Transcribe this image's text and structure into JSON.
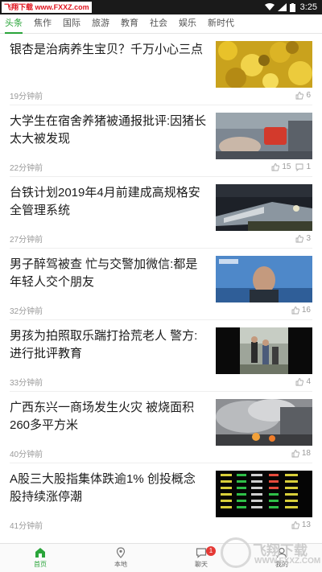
{
  "status_bar": {
    "watermark": "飞翔下载 www.FXXZ.com",
    "time": "3:25"
  },
  "tabs": [
    {
      "label": "头条",
      "active": true
    },
    {
      "label": "焦作"
    },
    {
      "label": "国际"
    },
    {
      "label": "旅游"
    },
    {
      "label": "教育"
    },
    {
      "label": "社会"
    },
    {
      "label": "娱乐"
    },
    {
      "label": "新时代"
    }
  ],
  "news": [
    {
      "title": "银杏是治病养生宝贝？千万小心三点",
      "time": "19分钟前",
      "likes": "6",
      "thumb": "ginkgo-leaves"
    },
    {
      "title": "大学生在宿舍养猪被通报批评:因猪长太大被发现",
      "time": "22分钟前",
      "likes": "15",
      "comments": "1",
      "thumb": "pig-in-dorm"
    },
    {
      "title": "台铁计划2019年4月前建成高规格安全管理系统",
      "time": "27分钟前",
      "likes": "3",
      "thumb": "train-accident"
    },
    {
      "title": "男子醉驾被查 忙与交警加微信:都是年轻人交个朋友",
      "time": "32分钟前",
      "likes": "16",
      "thumb": "drunk-driver"
    },
    {
      "title": "男孩为拍照取乐踹打拾荒老人 警方:进行批评教育",
      "time": "33分钟前",
      "likes": "4",
      "thumb": "boys-street"
    },
    {
      "title": "广西东兴一商场发生火灾 被烧面积260多平方米",
      "time": "40分钟前",
      "likes": "18",
      "thumb": "mall-fire"
    },
    {
      "title": "A股三大股指集体跌逾1% 创投概念股持续涨停潮",
      "time": "41分钟前",
      "likes": "13",
      "thumb": "stock-board"
    }
  ],
  "bottom_nav": [
    {
      "label": "首页",
      "icon": "home-icon",
      "active": true
    },
    {
      "label": "本地",
      "icon": "location-icon"
    },
    {
      "label": "聊天",
      "icon": "chat-icon",
      "badge": "1"
    },
    {
      "label": "我的",
      "icon": "profile-icon"
    }
  ],
  "site_watermark": {
    "text": "飞翔下载",
    "url": "WWW.FXXZ.COM"
  },
  "colors": {
    "accent": "#2aa53a",
    "badge": "#e53935"
  }
}
